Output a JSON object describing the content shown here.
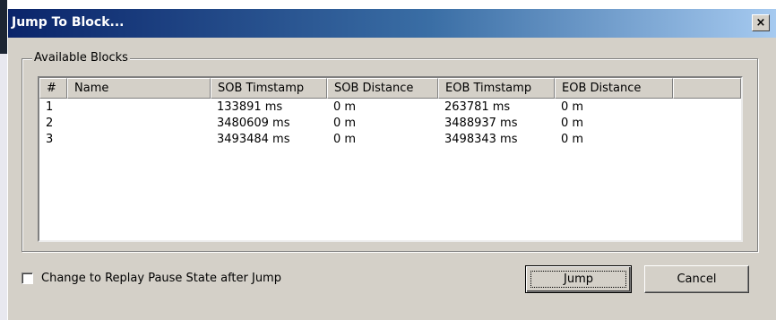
{
  "dialog": {
    "title": "Jump To Block...",
    "close_glyph": "×"
  },
  "group": {
    "label": "Available Blocks"
  },
  "table": {
    "columns": [
      "#",
      "Name",
      "SOB Timstamp",
      "SOB Distance",
      "EOB Timstamp",
      "EOB Distance"
    ],
    "rows": [
      [
        "1",
        "",
        "133891 ms",
        "0 m",
        "263781 ms",
        "0 m"
      ],
      [
        "2",
        "",
        "3480609 ms",
        "0 m",
        "3488937 ms",
        "0 m"
      ],
      [
        "3",
        "",
        "3493484 ms",
        "0 m",
        "3498343 ms",
        "0 m"
      ]
    ]
  },
  "options": {
    "pause_label": "Change to Replay Pause State after Jump",
    "pause_checked": false
  },
  "buttons": {
    "jump": "Jump",
    "cancel": "Cancel"
  }
}
